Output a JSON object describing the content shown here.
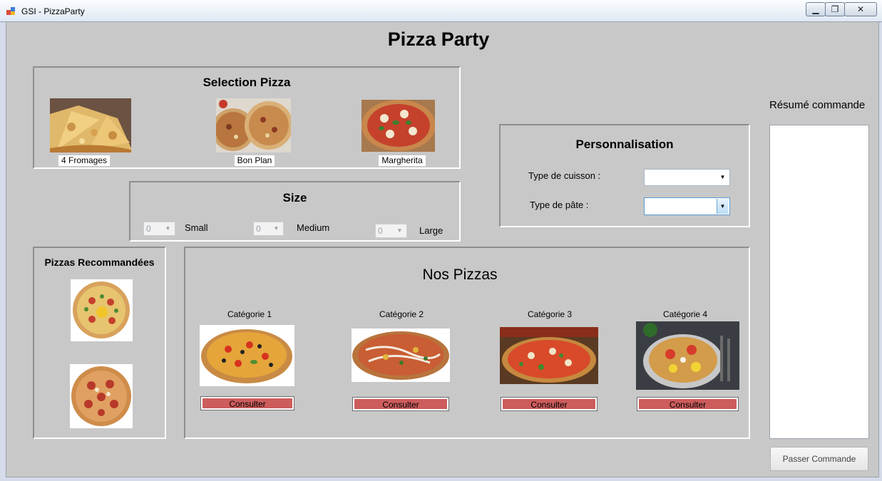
{
  "window": {
    "title": "GSI - PizzaParty",
    "minimize": "▁",
    "maximize": "❐",
    "close": "✕"
  },
  "app_title": "Pizza Party",
  "selection": {
    "title": "Selection Pizza",
    "pizzas": [
      {
        "name": "4 Fromages",
        "icon": "cheese-pizza-photo"
      },
      {
        "name": "Bon Plan",
        "icon": "bon-plan-pizza-photo"
      },
      {
        "name": "Margherita",
        "icon": "margherita-pizza-photo"
      }
    ]
  },
  "size": {
    "title": "Size",
    "options": [
      {
        "label": "Small",
        "value": "0"
      },
      {
        "label": "Medium",
        "value": "0"
      },
      {
        "label": "Large",
        "value": "0"
      }
    ]
  },
  "personnalisation": {
    "title": "Personnalisation",
    "cuisson_label": "Type de cuisson :",
    "pate_label": "Type de pâte :",
    "cuisson_value": "",
    "pate_value": ""
  },
  "recommended": {
    "title": "Pizzas Recommandées"
  },
  "nos_pizzas": {
    "title": "Nos Pizzas",
    "categories": [
      {
        "label": "Catégorie 1",
        "button": "Consulter"
      },
      {
        "label": "Catégorie 2",
        "button": "Consulter"
      },
      {
        "label": "Catégorie 3",
        "button": "Consulter"
      },
      {
        "label": "Catégorie 4",
        "button": "Consulter"
      }
    ]
  },
  "summary": {
    "title": "Résumé commande",
    "content": ""
  },
  "order_button": "Passer Commande",
  "colors": {
    "background": "#c8c8c8",
    "button_accent": "#cd5c5c"
  }
}
